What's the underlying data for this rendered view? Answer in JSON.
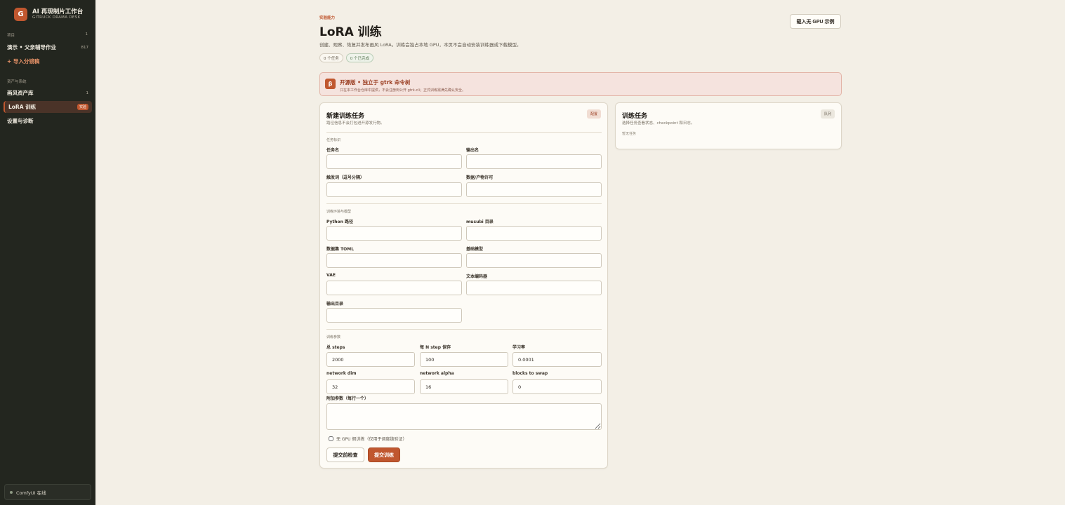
{
  "app": {
    "logo_letter": "G",
    "title": "AI 再现制片工作台",
    "subtitle": "GITRUCK DRAMA DESK"
  },
  "sidebar": {
    "section_projects": "项目",
    "section_projects_count": "1",
    "project_item": {
      "label": "演示 • 父亲辅导作业",
      "meta": "817"
    },
    "import_item": {
      "label": "+ 导入分镜稿"
    },
    "section_assets": "资产与系统",
    "items": [
      {
        "label": "画风资产库",
        "meta": "1"
      },
      {
        "label": "LoRA 训练",
        "badge": "实验"
      },
      {
        "label": "设置与诊断"
      }
    ],
    "status": "ComfyUI 在线"
  },
  "header": {
    "eyebrow": "实验能力",
    "title": "LoRA 训练",
    "description": "创建、观察、恢复并发布画风 LoRA。训练会独占本地 GPU，本页不会自动安装训练器或下载模型。",
    "chips": [
      "0 个任务",
      "0 个已完成"
    ],
    "gpu_button": "载入无 GPU 示例"
  },
  "alert": {
    "icon": "β",
    "title": "开源版 • 独立于 gtrk 命令树",
    "text": "只在本工作台仓库中提供，不会注册到公开 gtrk-cli；正式训练需满先确认安全。"
  },
  "form": {
    "title": "新建训练任务",
    "subtitle": "路径信息不会打包进开源发行物。",
    "tag": "配置",
    "group_identity": "任务标识",
    "task_name_label": "任务名",
    "output_name_label": "输出名",
    "trigger_label": "触发词（逗号分隔）",
    "license_label": "数据/产物许可",
    "group_env": "训练环境与模型",
    "python_label": "Python 路径",
    "musubi_label": "musubi 目录",
    "dataset_label": "数据集 TOML",
    "base_model_label": "基础模型",
    "vae_label": "VAE",
    "text_encoder_label": "文本编码器",
    "output_dir_label": "输出目录",
    "group_params": "训练参数",
    "steps_label": "总 steps",
    "steps_value": "2000",
    "save_every_label": "每 N step 保存",
    "save_every_value": "100",
    "lr_label": "学习率",
    "lr_value": "0.0001",
    "dim_label": "network dim",
    "dim_value": "32",
    "alpha_label": "network alpha",
    "alpha_value": "16",
    "swap_label": "blocks to swap",
    "swap_value": "0",
    "extra_label": "附加参数（每行一个）",
    "no_gpu_label": "无 GPU 假训练（仅用于调度链验证）",
    "check_button": "提交前检查",
    "submit_button": "提交训练"
  },
  "queue": {
    "title": "训练任务",
    "subtitle": "选择任务查看状态、checkpoint 和日志。",
    "tag": "队列",
    "empty": "暂无任务"
  }
}
